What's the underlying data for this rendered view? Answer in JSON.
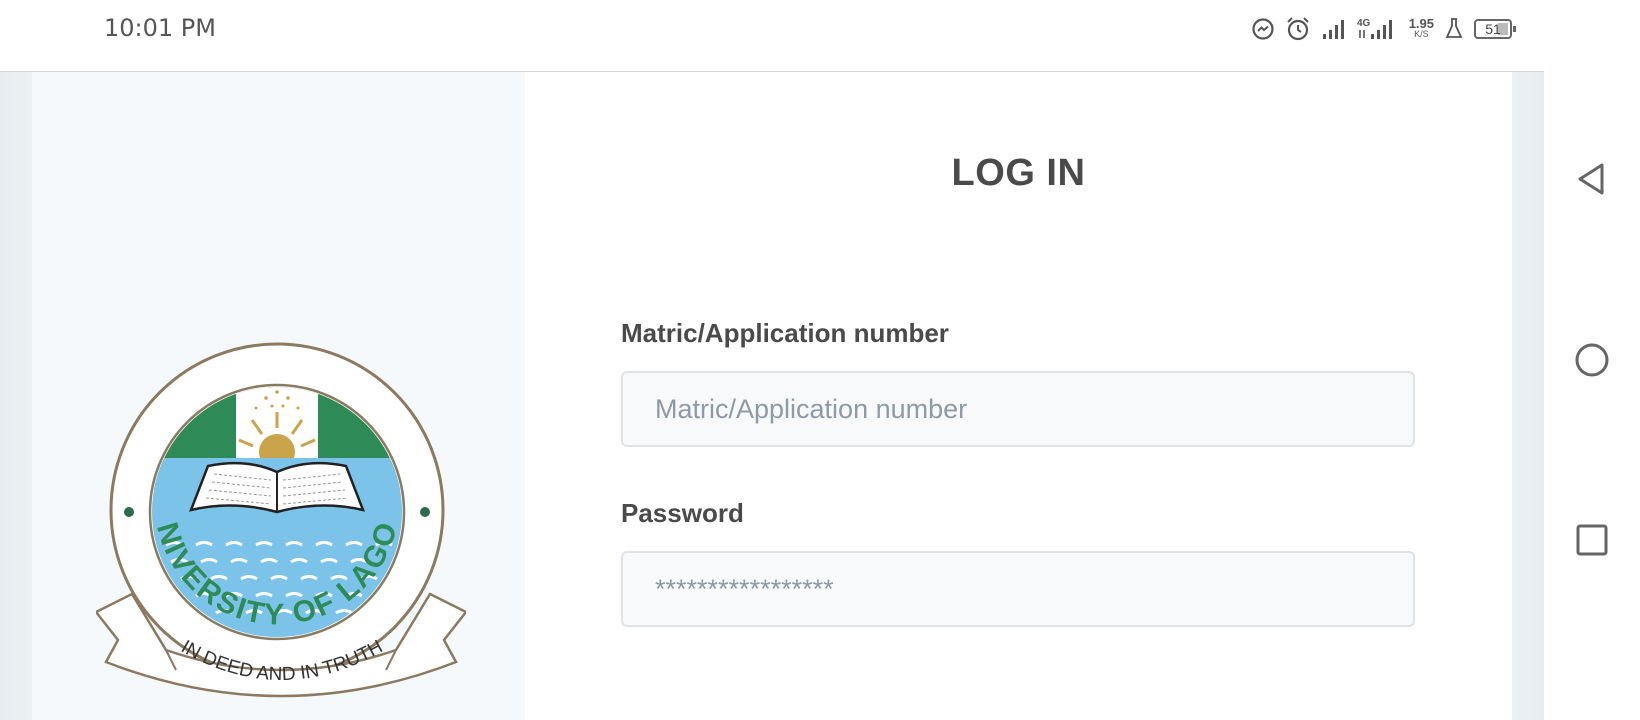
{
  "status_bar": {
    "time": "10:01 PM",
    "network_type": "4G",
    "speed_value": "1.95",
    "speed_unit": "K/S",
    "battery": "51",
    "icons": [
      "messenger-icon",
      "alarm-icon",
      "signal-icon",
      "signal-4g-icon",
      "lab-icon",
      "battery-icon"
    ]
  },
  "login": {
    "title": "LOG IN",
    "matric_label": "Matric/Application number",
    "matric_placeholder": "Matric/Application number",
    "password_label": "Password",
    "password_placeholder": "*****************"
  },
  "logo": {
    "top_text": "UNIVERSITY OF LAGOS",
    "motto": "IN DEED AND IN TRUTH",
    "colors": {
      "green": "#2e8b57",
      "water": "#7cc3ea",
      "ring": "#8a7a60"
    }
  },
  "nav_bar": {
    "buttons": [
      "back-icon",
      "home-icon",
      "recents-icon"
    ]
  }
}
